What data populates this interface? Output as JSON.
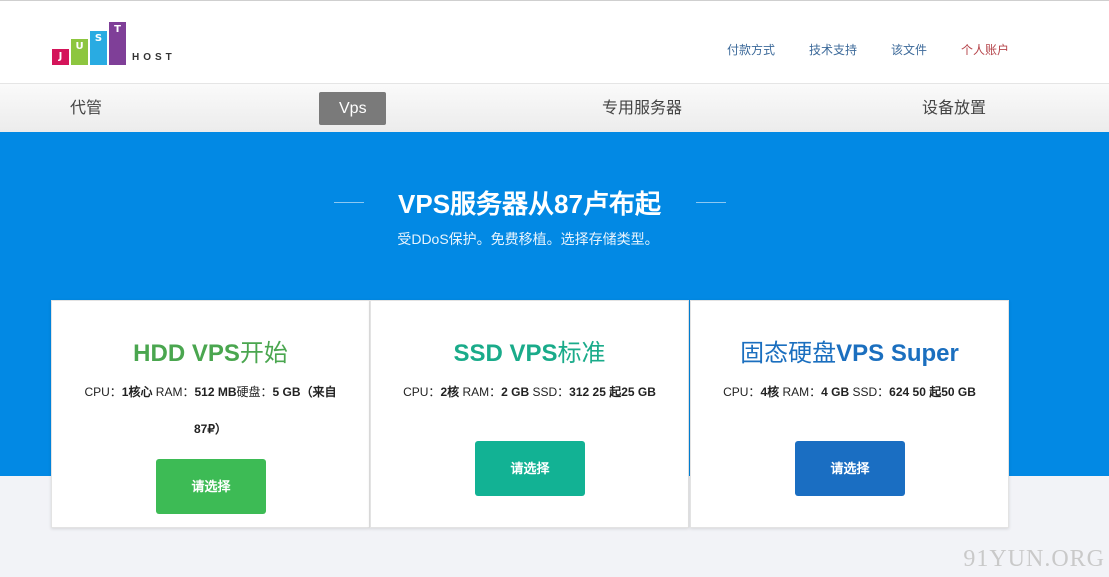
{
  "logo": {
    "letters": [
      "J",
      "U",
      "S",
      "T"
    ],
    "host": "HOST",
    "colors": [
      "#d4145a",
      "#8dc63f",
      "#29abe2",
      "#7f3f98"
    ]
  },
  "top_links": {
    "payment": "付款方式",
    "support": "技术支持",
    "docs": "该文件",
    "account": "个人账户"
  },
  "nav": {
    "items": [
      "代管",
      "Vps",
      "专用服务器",
      "设备放置"
    ],
    "active": "Vps"
  },
  "hero": {
    "title": "VPS服务器从87卢布起",
    "subtitle": "受DDoS保护。免费移植。选择存储类型。"
  },
  "cards": [
    {
      "title_bold": "HDD VPS",
      "title_thin": "开始",
      "spec_label1": "CPU：",
      "spec_val1": "1核心",
      "spec_label2": " RAM：",
      "spec_val2": "512 MB",
      "spec_label3": "硬盘：",
      "spec_val3": "5 GB（来自87₽）",
      "button": "请选择",
      "color": "#4aa64f",
      "button_color": "#3dbb55"
    },
    {
      "title_bold": "SSD VPS",
      "title_thin": "标准",
      "spec_label1": "CPU：",
      "spec_val1": "2核",
      "spec_label2": " RAM：",
      "spec_val2": "2 GB",
      "spec_label3": " SSD：",
      "spec_val3": "312 25 起25 GB",
      "button": "请选择",
      "color": "#1aab8a",
      "button_color": "#12b294"
    },
    {
      "title_bold": "VPS Super",
      "title_thin": "固态硬盘",
      "spec_label1": "CPU：",
      "spec_val1": "4核",
      "spec_label2": " RAM：",
      "spec_val2": "4 GB",
      "spec_label3": " SSD：",
      "spec_val3": "624 50 起50 GB",
      "button": "请选择",
      "color": "#1b6fbf",
      "button_color": "#1a6ec2"
    }
  ],
  "watermark": "91YUN.ORG"
}
